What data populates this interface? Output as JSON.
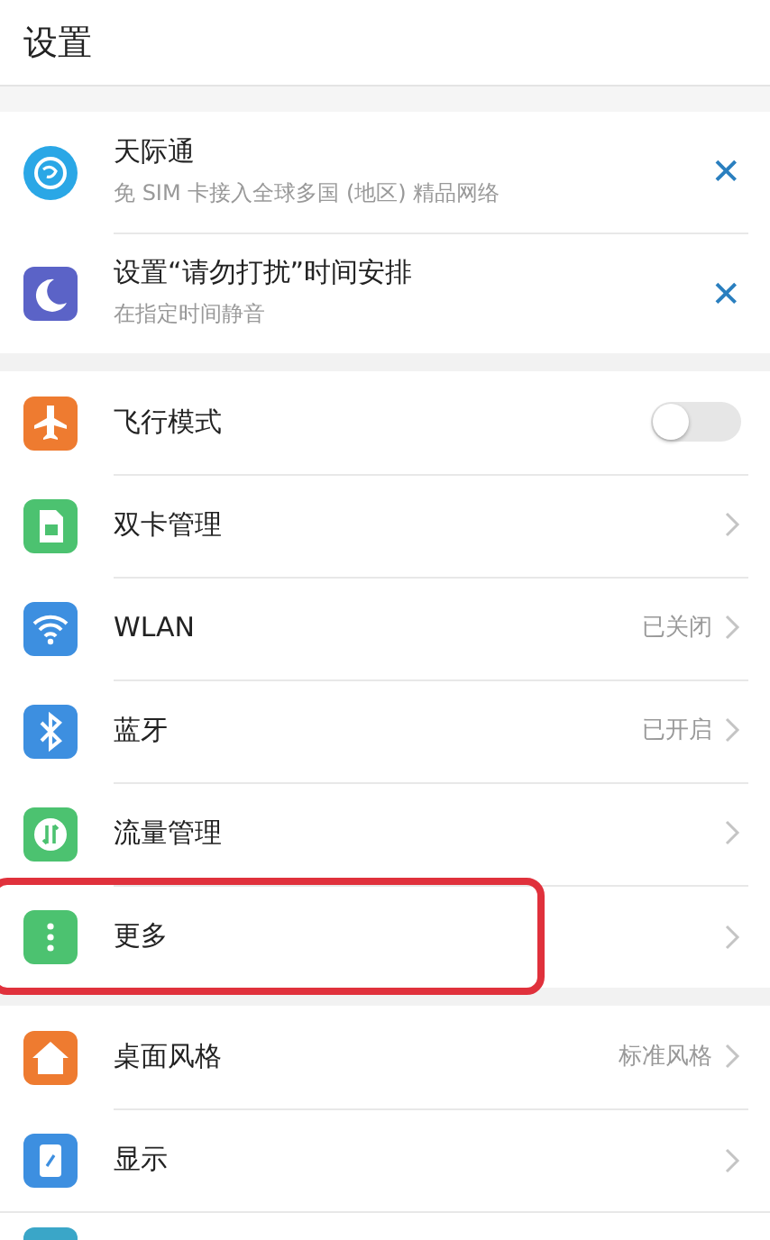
{
  "header": {
    "title": "设置"
  },
  "suggestions": [
    {
      "title": "天际通",
      "subtitle": "免 SIM 卡接入全球多国 (地区) 精品网络",
      "dismiss": "✕"
    },
    {
      "title": "设置“请勿打扰”时间安排",
      "subtitle": "在指定时间静音",
      "dismiss": "✕"
    }
  ],
  "groups": [
    {
      "items": [
        {
          "kind": "toggle",
          "label": "飞行模式",
          "on": false,
          "highlighted": false
        },
        {
          "kind": "link",
          "label": "双卡管理",
          "highlighted": false
        },
        {
          "kind": "link",
          "label": "WLAN",
          "value": "已关闭",
          "highlighted": false
        },
        {
          "kind": "link",
          "label": "蓝牙",
          "value": "已开启",
          "highlighted": false
        },
        {
          "kind": "link",
          "label": "流量管理",
          "highlighted": false
        },
        {
          "kind": "link",
          "label": "更多",
          "highlighted": true
        }
      ]
    },
    {
      "items": [
        {
          "kind": "link",
          "label": "桌面风格",
          "value": "标准风格",
          "highlighted": false
        },
        {
          "kind": "link",
          "label": "显示",
          "highlighted": false
        }
      ]
    }
  ]
}
